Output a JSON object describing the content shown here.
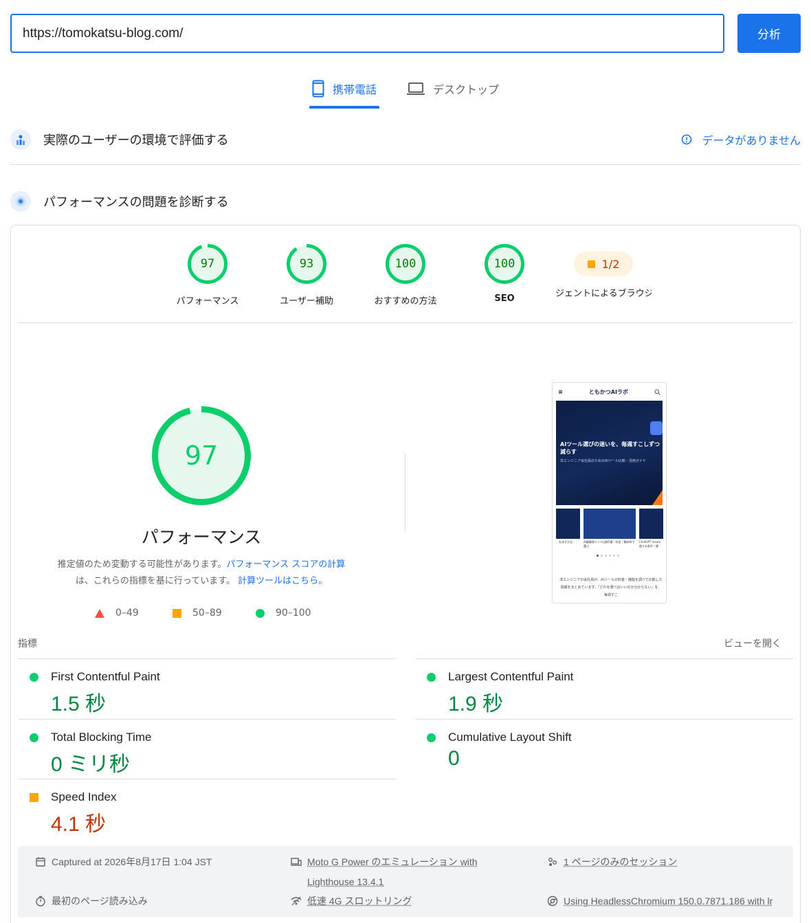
{
  "search": {
    "url": "https://tomokatsu-blog.com/",
    "analyze_label": "分析"
  },
  "tabs": {
    "mobile": "携帯電話",
    "desktop": "デスクトップ"
  },
  "field_data": {
    "title": "実際のユーザーの環境で評価する",
    "no_data": "データがありません"
  },
  "lab_data": {
    "title": "パフォーマンスの問題を診断する"
  },
  "categories": [
    {
      "label": "パフォーマンス",
      "score": "97",
      "value": 97
    },
    {
      "label": "ユーザー補助",
      "score": "93",
      "value": 93
    },
    {
      "label": "おすすめの方法",
      "score": "100",
      "value": 100
    },
    {
      "label": "SEO",
      "score": "100",
      "value": 100
    }
  ],
  "pwa": {
    "label": "ジェントによるブラウジ",
    "value": "1/2"
  },
  "performance": {
    "score": "97",
    "title": "パフォーマンス",
    "desc_1": "推定値のため変動する可能性があります。",
    "desc_link_1": "パフォーマンス スコアの計算",
    "desc_2": "は、これらの指標を基に行っています。",
    "desc_link_2": "計算ツールはこちら。"
  },
  "legend": {
    "fail": "0–49",
    "average": "50–89",
    "pass": "90–100"
  },
  "screenshot": {
    "site_name": "ともかつAIラボ",
    "hero_title": "AIツール選びの迷いを、毎週すこしずつ減らす",
    "hero_sub": "非エンジニア会社員のためのAIツール比較・活用ガイド",
    "cap_1": "…を決す方法｜",
    "cap_2": "AI議事録ツール比較5選｜料金・無料枠で選ぶ",
    "cap_3": "ChatGPT recom 使える条件｜課",
    "body_text": "非エンジニアの会社員が、AIツールの料金・機能を調べて比較した情報をまとめています。「どれを選べばいいのか分からない」を、毎週すこ"
  },
  "metrics_header": {
    "label": "指標",
    "expand": "ビューを開く"
  },
  "metrics": [
    {
      "name": "First Contentful Paint",
      "value": "1.5 秒",
      "status": "pass"
    },
    {
      "name": "Largest Contentful Paint",
      "value": "1.9 秒",
      "status": "pass"
    },
    {
      "name": "Total Blocking Time",
      "value": "0 ミリ秒",
      "status": "pass"
    },
    {
      "name": "Cumulative Layout Shift",
      "value": "0",
      "status": "pass"
    },
    {
      "name": "Speed Index",
      "value": "4.1 秒",
      "status": "average"
    }
  ],
  "run_info": {
    "captured": "Captured at 2026年8月17日 1:04 JST",
    "device_1": "Moto G Power のエミュレーション with",
    "device_2": "Lighthouse 13.4.1",
    "session": "1 ページのみのセッション",
    "load": "最初のページ読み込み",
    "throttling": "低速 4G スロットリング",
    "browser": "Using HeadlessChromium 150.0.7871.186 with lr"
  },
  "colors": {
    "accent": "#1a73e8",
    "pass": "#0cce6b",
    "average": "#ffa400",
    "fail": "#ff4e42"
  }
}
